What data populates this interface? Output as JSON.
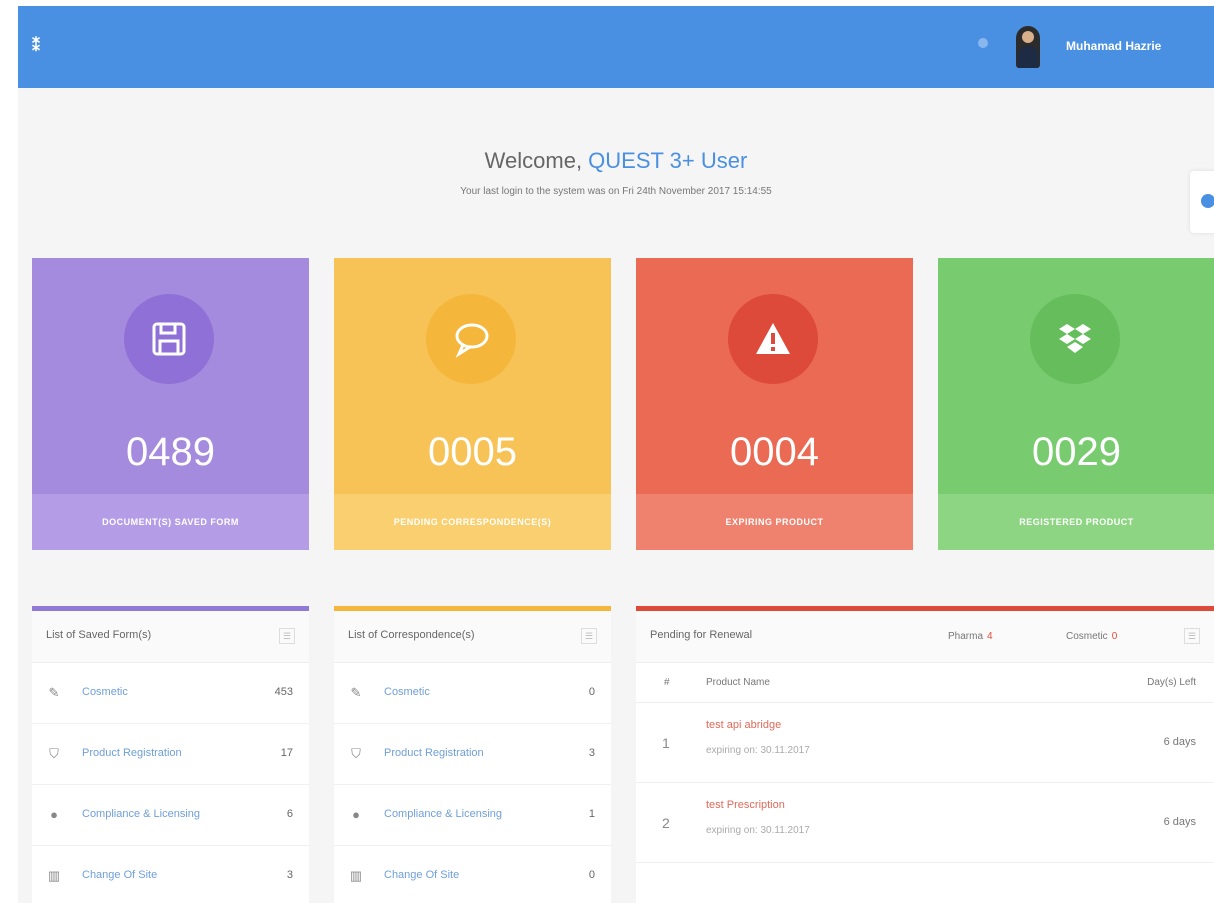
{
  "topbar": {
    "menu_glyph": "⁑",
    "user_name": "Muhamad Hazrie",
    "accent": "#4a90e2"
  },
  "welcome": {
    "prefix": "Welcome, ",
    "app": "QUEST 3+ User",
    "last_login": "Your last login to the system was on Fri 24th November 2017 15:14:55"
  },
  "stats": [
    {
      "value": "0489",
      "label": "DOCUMENT(S) SAVED FORM",
      "icon": "floppy-disk-icon",
      "color": "#a58bde"
    },
    {
      "value": "0005",
      "label": "PENDING CORRESPONDENCE(S)",
      "icon": "speech-bubble-icon",
      "color": "#f7c357"
    },
    {
      "value": "0004",
      "label": "EXPIRING PRODUCT",
      "icon": "warning-triangle-icon",
      "color": "#ea6a54"
    },
    {
      "value": "0029",
      "label": "REGISTERED PRODUCT",
      "icon": "dropbox-icon",
      "color": "#79cb6f"
    }
  ],
  "saved_forms": {
    "title": "List of Saved Form(s)",
    "items": [
      {
        "label": "Cosmetic",
        "count": "453",
        "icon": "pen-icon"
      },
      {
        "label": "Product Registration",
        "count": "17",
        "icon": "shield-icon"
      },
      {
        "label": "Compliance & Licensing",
        "count": "6",
        "icon": "circle-icon"
      },
      {
        "label": "Change Of Site",
        "count": "3",
        "icon": "building-icon"
      }
    ]
  },
  "correspondences": {
    "title": "List of Correspondence(s)",
    "items": [
      {
        "label": "Cosmetic",
        "count": "0",
        "icon": "pen-icon"
      },
      {
        "label": "Product Registration",
        "count": "3",
        "icon": "shield-icon"
      },
      {
        "label": "Compliance & Licensing",
        "count": "1",
        "icon": "circle-icon"
      },
      {
        "label": "Change Of Site",
        "count": "0",
        "icon": "building-icon"
      }
    ]
  },
  "renewal": {
    "title": "Pending for Renewal",
    "tabs": [
      {
        "label": "Pharma",
        "badge": "4"
      },
      {
        "label": "Cosmetic",
        "badge": "0"
      }
    ],
    "columns": {
      "index": "#",
      "name": "Product Name",
      "days": "Day(s) Left"
    },
    "rows": [
      {
        "index": "1",
        "name": "test api abridge",
        "expiry": "expiring on: 30.11.2017",
        "days": "6 days"
      },
      {
        "index": "2",
        "name": "test Prescription",
        "expiry": "expiring on: 30.11.2017",
        "days": "6 days"
      }
    ]
  }
}
